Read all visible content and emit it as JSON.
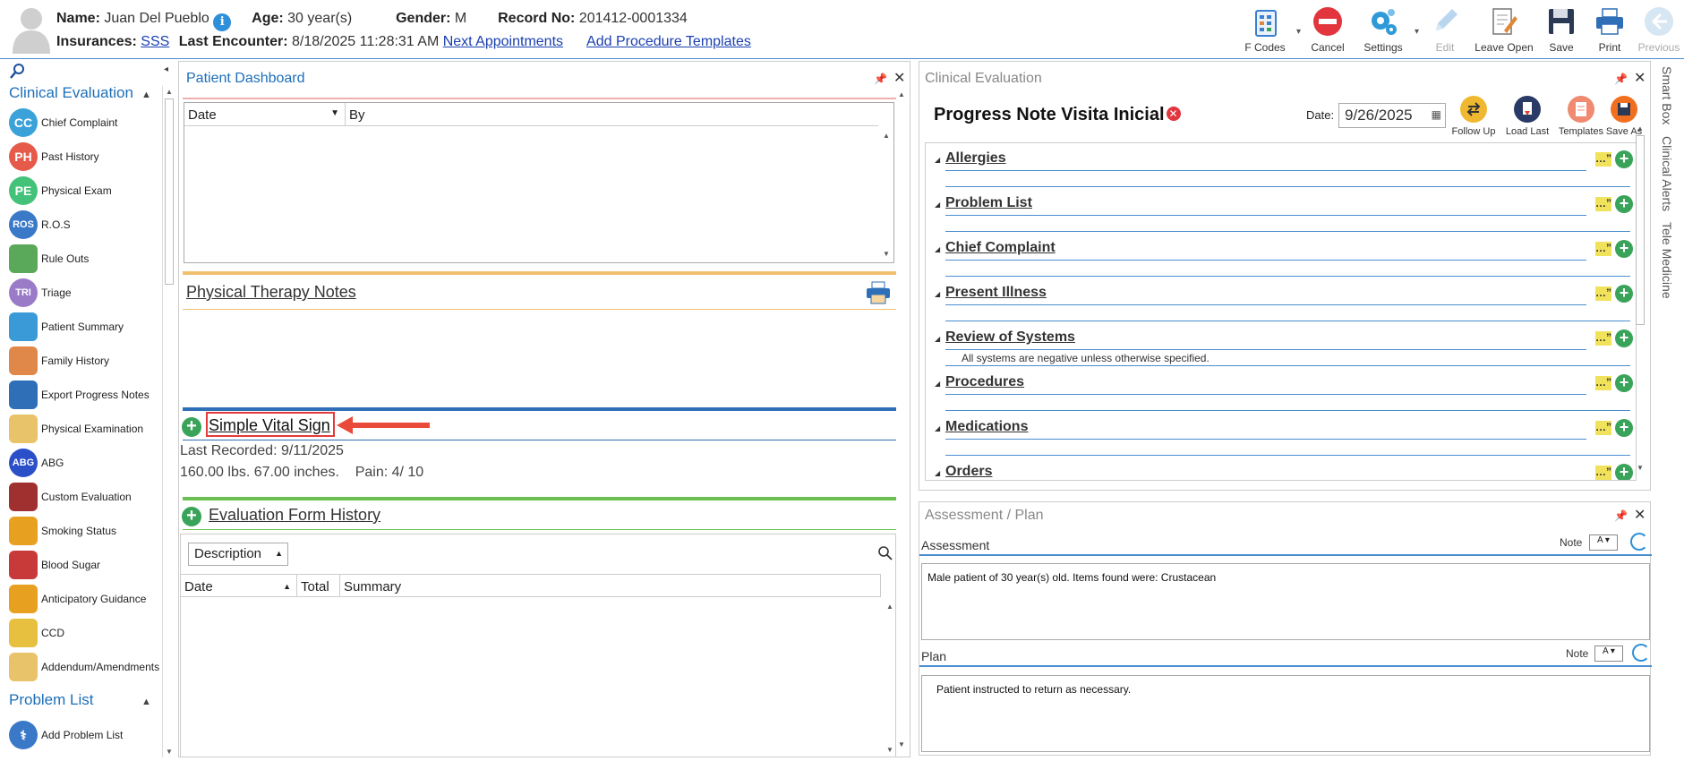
{
  "header": {
    "name_label": "Name:",
    "name": "Juan Del Pueblo",
    "age_label": "Age:",
    "age": "30 year(s)",
    "gender_label": "Gender:",
    "gender": "M",
    "record_label": "Record No:",
    "record": "201412-0001334",
    "insurances_label": "Insurances:",
    "insurance": "SSS",
    "last_encounter_label": "Last Encounter:",
    "last_encounter": "8/18/2025 11:28:31 AM",
    "next_appointments": "Next Appointments",
    "add_procedure_templates": "Add Procedure Templates",
    "info_glyph": "i"
  },
  "toolbar": {
    "fcodes": "F Codes",
    "cancel": "Cancel",
    "settings": "Settings",
    "edit": "Edit",
    "leave_open": "Leave Open",
    "save": "Save",
    "print": "Print",
    "previous": "Previous"
  },
  "leftnav": {
    "clinical_evaluation": "Clinical Evaluation",
    "problem_list": "Problem List",
    "items": [
      {
        "label": "Chief Complaint",
        "abbr": "CC",
        "color": "#3aa2d8"
      },
      {
        "label": "Past History",
        "abbr": "PH",
        "color": "#e55a4a"
      },
      {
        "label": "Physical Exam",
        "abbr": "PE",
        "color": "#44c27a"
      },
      {
        "label": "R.O.S",
        "abbr": "ROS",
        "color": "#3a78c8"
      },
      {
        "label": "Rule Outs",
        "abbr": "",
        "color": "#5aa85a"
      },
      {
        "label": "Triage",
        "abbr": "TRI",
        "color": "#9a7bc8"
      },
      {
        "label": "Patient Summary",
        "abbr": "",
        "color": "#3a9ad8"
      },
      {
        "label": "Family History",
        "abbr": "",
        "color": "#e0884a"
      },
      {
        "label": "Export Progress Notes",
        "abbr": "",
        "color": "#2f6fb8"
      },
      {
        "label": "Physical Examination",
        "abbr": "",
        "color": "#e8c36a"
      },
      {
        "label": "ABG",
        "abbr": "ABG",
        "color": "#2a4fc8"
      },
      {
        "label": "Custom Evaluation",
        "abbr": "",
        "color": "#a03030"
      },
      {
        "label": "Smoking Status",
        "abbr": "",
        "color": "#e8a020"
      },
      {
        "label": "Blood Sugar",
        "abbr": "",
        "color": "#c83a3a"
      },
      {
        "label": "Anticipatory Guidance",
        "abbr": "",
        "color": "#e8a020"
      },
      {
        "label": "CCD",
        "abbr": "",
        "color": "#e8c040"
      },
      {
        "label": "Addendum/Amendments",
        "abbr": "",
        "color": "#e8c36a"
      }
    ],
    "add_problem_list": "Add Problem List"
  },
  "dashboard": {
    "title": "Patient Dashboard",
    "grid_cols": [
      "Date",
      "By"
    ],
    "pt_notes": "Physical Therapy Notes",
    "vital_sign": "Simple Vital Sign",
    "last_recorded": "Last Recorded: 9/11/2025",
    "vitals_line": "160.00 lbs. 67.00 inches.    Pain: 4/ 10",
    "eval_history": "Evaluation Form History",
    "description_dd": "Description",
    "hist_cols": [
      "Date",
      "Total",
      "Summary"
    ]
  },
  "clinical_eval": {
    "title": "Clinical Evaluation",
    "note_title": "Progress Note Visita Inicial",
    "date_label": "Date:",
    "date": "9/26/2025",
    "buttons": [
      "Follow Up",
      "Load Last",
      "Templates",
      "Save As"
    ],
    "sections": [
      {
        "name": "Allergies",
        "note": ""
      },
      {
        "name": "Problem List",
        "note": ""
      },
      {
        "name": "Chief Complaint",
        "note": ""
      },
      {
        "name": "Present Illness",
        "note": ""
      },
      {
        "name": "Review of Systems",
        "note": "All systems are negative unless otherwise specified."
      },
      {
        "name": "Procedures",
        "note": ""
      },
      {
        "name": "Medications",
        "note": ""
      },
      {
        "name": "Orders",
        "note": ""
      }
    ]
  },
  "assessment_plan": {
    "title": "Assessment / Plan",
    "assessment_label": "Assessment",
    "plan_label": "Plan",
    "note_label": "Note",
    "assessment_text": "Male patient of 30 year(s) old. Items found were:  Crustacean",
    "plan_text": "Patient instructed to return as necessary."
  },
  "side_tabs": [
    "Smart Box",
    "Clinical Alerts",
    "Tele Medicine"
  ]
}
